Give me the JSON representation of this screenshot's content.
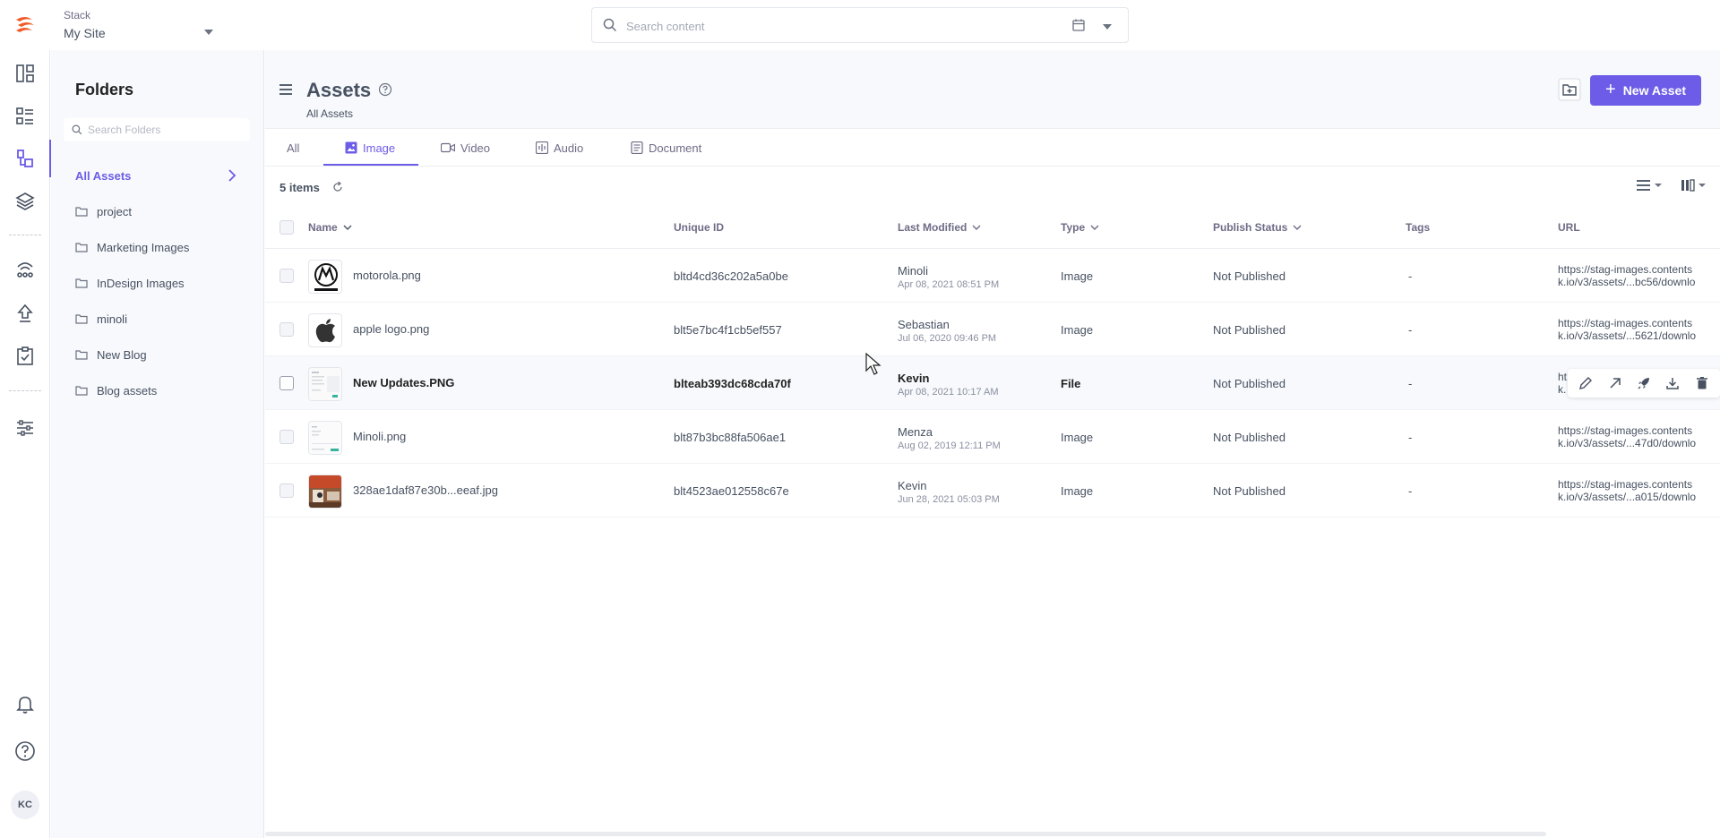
{
  "topbar": {
    "stack_label": "Stack",
    "stack_name": "My Site",
    "search_placeholder": "Search content"
  },
  "folders": {
    "title": "Folders",
    "search_placeholder": "Search Folders",
    "all_assets_label": "All Assets",
    "items": [
      {
        "label": "project"
      },
      {
        "label": "Marketing Images"
      },
      {
        "label": "InDesign Images"
      },
      {
        "label": "minoli"
      },
      {
        "label": "New Blog"
      },
      {
        "label": "Blog assets"
      }
    ]
  },
  "header": {
    "title": "Assets",
    "breadcrumb": "All Assets",
    "new_asset_label": "New Asset"
  },
  "tabs": [
    {
      "label": "All"
    },
    {
      "label": "Image"
    },
    {
      "label": "Video"
    },
    {
      "label": "Audio"
    },
    {
      "label": "Document"
    }
  ],
  "toolbar": {
    "items_count": "5 items"
  },
  "table": {
    "columns": {
      "name": "Name",
      "uid": "Unique ID",
      "modified": "Last Modified",
      "type": "Type",
      "status": "Publish Status",
      "tags": "Tags",
      "url": "URL"
    },
    "rows": [
      {
        "name": "motorola.png",
        "uid": "bltd4cd36c202a5a0be",
        "modified_by": "Minoli",
        "modified_at": "Apr 08, 2021 08:51 PM",
        "type": "Image",
        "status": "Not Published",
        "tags": "-",
        "url1": "https://stag-images.contents",
        "url2": "k.io/v3/assets/...bc56/downlo"
      },
      {
        "name": "apple logo.png",
        "uid": "blt5e7bc4f1cb5ef557",
        "modified_by": "Sebastian",
        "modified_at": "Jul 06, 2020 09:46 PM",
        "type": "Image",
        "status": "Not Published",
        "tags": "-",
        "url1": "https://stag-images.contents",
        "url2": "k.io/v3/assets/...5621/downlo"
      },
      {
        "name": "New Updates.PNG",
        "uid": "blteab393dc68cda70f",
        "modified_by": "Kevin",
        "modified_at": "Apr 08, 2021 10:17 AM",
        "type": "File",
        "status": "Not Published",
        "tags": "-",
        "url1": "ht",
        "url2": "k."
      },
      {
        "name": "Minoli.png",
        "uid": "blt87b3bc88fa506ae1",
        "modified_by": "Menza",
        "modified_at": "Aug 02, 2019 12:11 PM",
        "type": "Image",
        "status": "Not Published",
        "tags": "-",
        "url1": "https://stag-images.contents",
        "url2": "k.io/v3/assets/...47d0/downlo"
      },
      {
        "name": "328ae1daf87e30b...eeaf.jpg",
        "uid": "blt4523ae012558c67e",
        "modified_by": "Kevin",
        "modified_at": "Jun 28, 2021 05:03 PM",
        "type": "Image",
        "status": "Not Published",
        "tags": "-",
        "url1": "https://stag-images.contents",
        "url2": "k.io/v3/assets/...a015/downlo"
      }
    ]
  },
  "user": {
    "initials": "KC"
  },
  "colors": {
    "accent": "#6c5ce7",
    "brand_logo": "#f15a29"
  }
}
